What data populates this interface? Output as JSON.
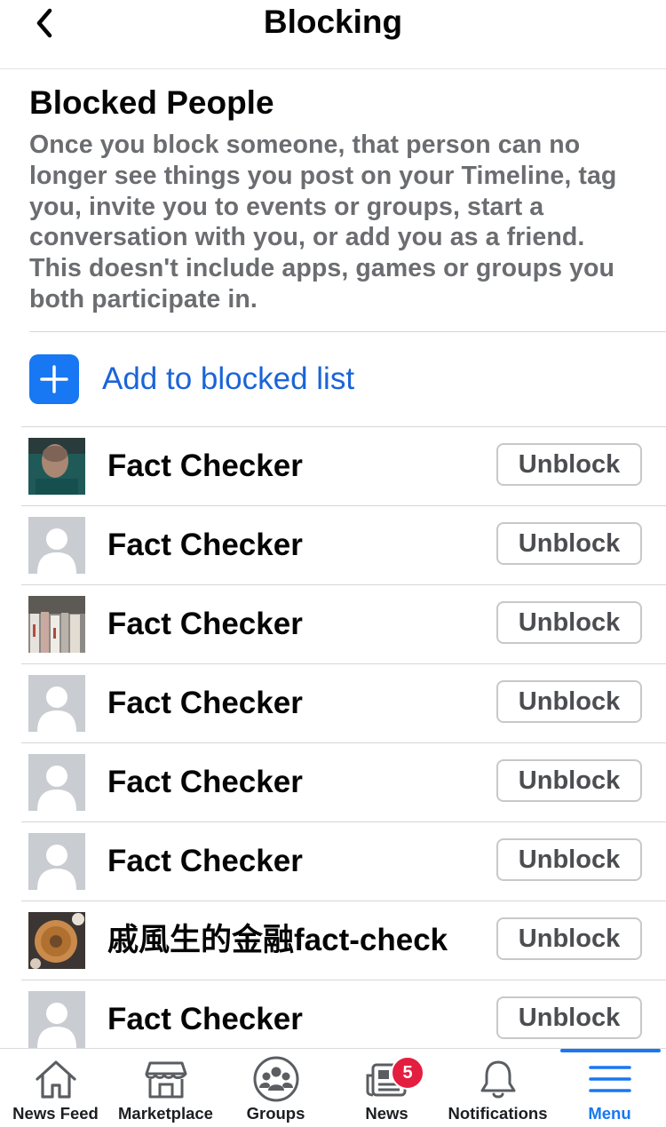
{
  "header": {
    "title": "Blocking"
  },
  "section": {
    "heading": "Blocked People",
    "description": "Once you block someone, that person can no longer see things you post on your Timeline, tag you, invite you to events or groups, start a conversation with you, or add you as a friend. This doesn't include apps, games or groups you both participate in."
  },
  "add_action": {
    "label": "Add to blocked list",
    "icon": "plus-icon"
  },
  "blocked": [
    {
      "name": "Fact Checker",
      "avatar": "photo-face",
      "button": "Unblock"
    },
    {
      "name": "Fact Checker",
      "avatar": "default-silhouette",
      "button": "Unblock"
    },
    {
      "name": "Fact Checker",
      "avatar": "photo-newspapers",
      "button": "Unblock"
    },
    {
      "name": "Fact Checker",
      "avatar": "default-silhouette",
      "button": "Unblock"
    },
    {
      "name": "Fact Checker",
      "avatar": "default-silhouette",
      "button": "Unblock"
    },
    {
      "name": "Fact Checker",
      "avatar": "default-silhouette",
      "button": "Unblock"
    },
    {
      "name": "戚風生的金融fact-check",
      "avatar": "photo-cake",
      "button": "Unblock"
    },
    {
      "name": "Fact Checker",
      "avatar": "default-silhouette",
      "button": "Unblock"
    }
  ],
  "tabs": [
    {
      "label": "News Feed",
      "icon": "home-icon"
    },
    {
      "label": "Marketplace",
      "icon": "shop-icon"
    },
    {
      "label": "Groups",
      "icon": "groups-icon"
    },
    {
      "label": "News",
      "icon": "newspaper-icon",
      "badge": "5"
    },
    {
      "label": "Notifications",
      "icon": "bell-icon"
    },
    {
      "label": "Menu",
      "icon": "menu-icon",
      "active": true
    }
  ],
  "colors": {
    "accent": "#1877f2",
    "badge": "#e41e3f",
    "description_text": "#6b6d70"
  }
}
